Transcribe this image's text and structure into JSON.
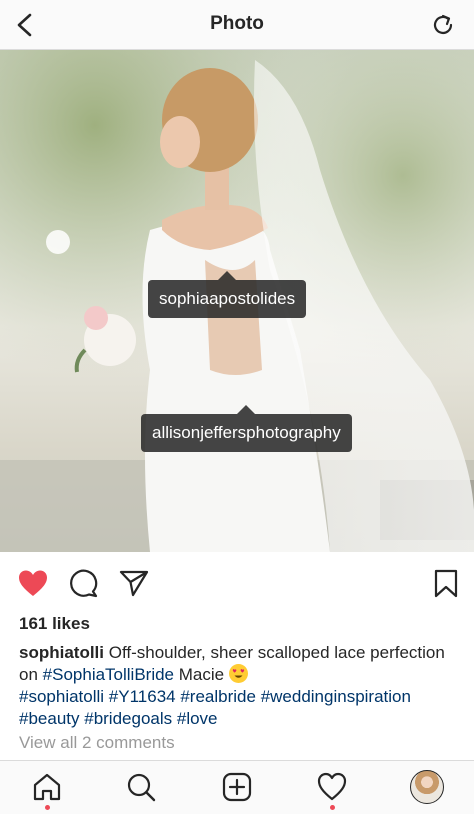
{
  "header": {
    "title": "Photo",
    "back_icon": "chevron-left-icon",
    "refresh_icon": "refresh-icon"
  },
  "photo": {
    "tags": [
      {
        "label": "sophiaapostolides"
      },
      {
        "label": "allisonjeffersphotography"
      }
    ]
  },
  "actions": {
    "like_icon": "heart-filled-icon",
    "comment_icon": "comment-icon",
    "share_icon": "paper-plane-icon",
    "save_icon": "bookmark-icon",
    "like_color": "#ed4956"
  },
  "post": {
    "likes": "161 likes",
    "caption_user": "sophiatolli",
    "caption_line1": "Off-shoulder, sheer scalloped lace perfection on",
    "caption_tag1": "#SophiaTolliBride",
    "caption_name": "Macie",
    "hashtags": [
      "#sophiatolli",
      "#Y11634",
      "#realbride",
      "#weddinginspiration",
      "#beauty",
      "#bridegoals",
      "#love"
    ],
    "view_comments": "View all 2 comments"
  },
  "tabbar": {
    "items": [
      "home-icon",
      "search-icon",
      "add-icon",
      "activity-heart-icon",
      "profile-avatar"
    ],
    "notification_color": "#ed4956"
  }
}
